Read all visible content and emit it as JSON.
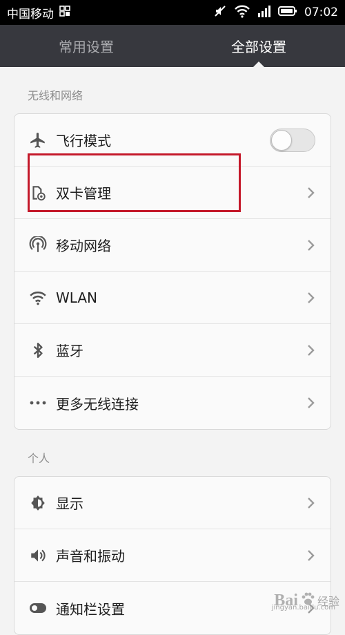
{
  "status_bar": {
    "carrier": "中国移动",
    "time": "07:02"
  },
  "tabs": [
    {
      "label": "常用设置",
      "active": false
    },
    {
      "label": "全部设置",
      "active": true
    }
  ],
  "sections": {
    "wireless": {
      "title": "无线和网络",
      "items": [
        {
          "label": "飞行模式",
          "icon": "airplane-icon",
          "control": "toggle",
          "toggle_on": false
        },
        {
          "label": "双卡管理",
          "icon": "dual-sim-icon",
          "control": "chevron"
        },
        {
          "label": "移动网络",
          "icon": "mobile-network-icon",
          "control": "chevron"
        },
        {
          "label": "WLAN",
          "icon": "wifi-icon",
          "control": "chevron"
        },
        {
          "label": "蓝牙",
          "icon": "bluetooth-icon",
          "control": "chevron"
        },
        {
          "label": "更多无线连接",
          "icon": "more-dots-icon",
          "control": "chevron"
        }
      ]
    },
    "personal": {
      "title": "个人",
      "items": [
        {
          "label": "显示",
          "icon": "brightness-icon",
          "control": "chevron"
        },
        {
          "label": "声音和振动",
          "icon": "sound-icon",
          "control": "chevron"
        },
        {
          "label": "通知栏设置",
          "icon": "notification-toggle-icon",
          "control": "chevron"
        }
      ]
    }
  },
  "watermark": {
    "brand": "Bai",
    "text": "经验",
    "url": "jingyan.baidu.com"
  },
  "colors": {
    "tab_bar": "#37383e",
    "highlight": "#c4182a",
    "background": "#f3f3f3"
  }
}
